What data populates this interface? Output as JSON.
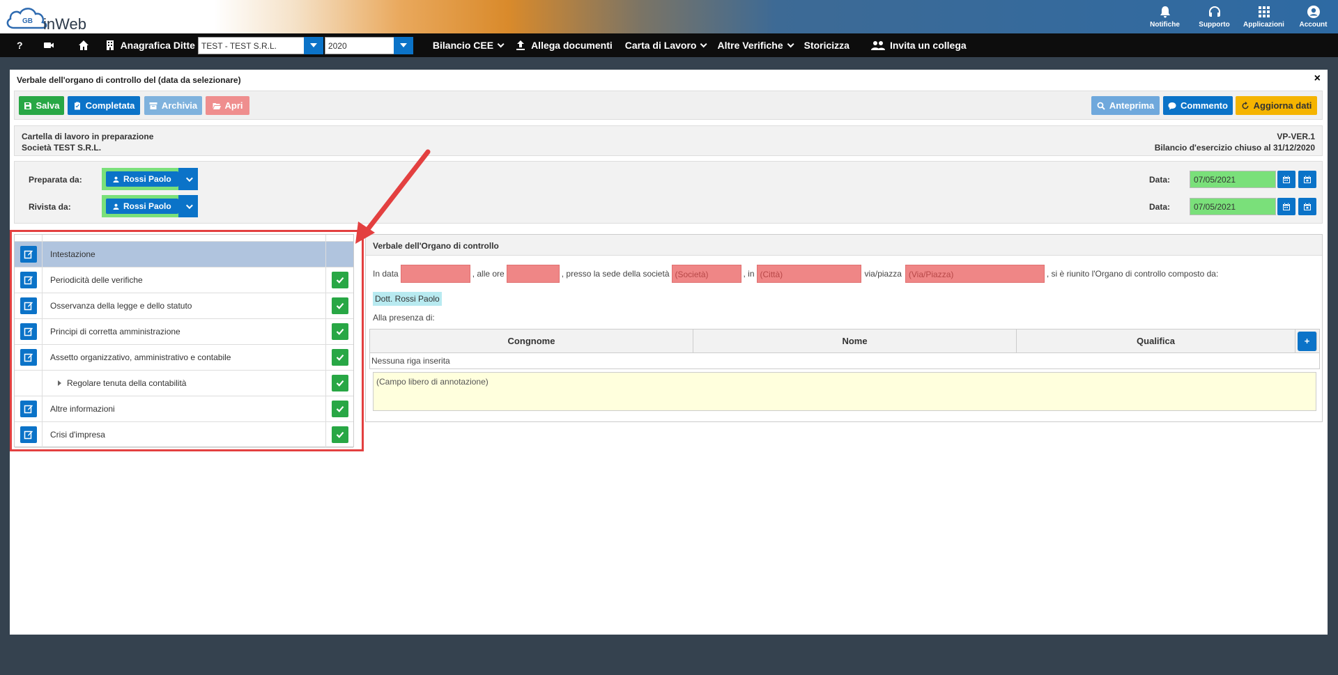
{
  "header": {
    "logo_text": "inWeb",
    "logo_badge": "GB",
    "icons": [
      {
        "label": "Notifiche",
        "icon": "bell-icon"
      },
      {
        "label": "Supporto",
        "icon": "headset-icon"
      },
      {
        "label": "Applicazioni",
        "icon": "grid-icon"
      },
      {
        "label": "Account",
        "icon": "user-circle-icon"
      }
    ]
  },
  "menubar": {
    "help": "?",
    "anagrafica": "Anagrafica Ditte",
    "company_value": "TEST - TEST S.R.L.",
    "year_value": "2020",
    "bilancio": "Bilancio CEE",
    "allega": "Allega documenti",
    "carta": "Carta di Lavoro",
    "altre": "Altre Verifiche",
    "storicizza": "Storicizza",
    "invita": "Invita un collega"
  },
  "panel": {
    "title": "Verbale dell'organo di controllo del (data da selezionare)",
    "close": "×"
  },
  "toolbar": {
    "salva": "Salva",
    "completata": "Completata",
    "archivia": "Archivia",
    "apri": "Apri",
    "anteprima": "Anteprima",
    "commento": "Commento",
    "aggiorna": "Aggiorna dati",
    "colors": {
      "green": "#28a745",
      "blue": "#0b73c8",
      "lightblue": "#7fb2dd",
      "pink": "#ef8e8e",
      "anteprima": "#6fa8dc",
      "orange": "#f5b400"
    }
  },
  "info": {
    "line1": "Cartella di lavoro in preparazione",
    "line2": "Società TEST S.R.L.",
    "right1": "VP-VER.1",
    "right2": "Bilancio d'esercizio chiuso al 31/12/2020"
  },
  "prep": {
    "preparata_label": "Preparata da:",
    "preparata_value": "Rossi Paolo",
    "rivista_label": "Rivista da:",
    "rivista_value": "Rossi Paolo",
    "data_label": "Data:",
    "data1": "07/05/2021",
    "data2": "07/05/2021"
  },
  "sections": [
    {
      "label": "Intestazione",
      "selected": true,
      "edit": true,
      "ok": false,
      "sub": false
    },
    {
      "label": "Periodicità delle verifiche",
      "selected": false,
      "edit": true,
      "ok": true,
      "sub": false
    },
    {
      "label": "Osservanza della legge e dello statuto",
      "selected": false,
      "edit": true,
      "ok": true,
      "sub": false
    },
    {
      "label": "Principi di corretta amministrazione",
      "selected": false,
      "edit": true,
      "ok": true,
      "sub": false
    },
    {
      "label": "Assetto organizzativo, amministrativo e contabile",
      "selected": false,
      "edit": true,
      "ok": true,
      "sub": false
    },
    {
      "label": "Regolare tenuta della contabilità",
      "selected": false,
      "edit": false,
      "ok": true,
      "sub": true
    },
    {
      "label": "Altre informazioni",
      "selected": false,
      "edit": true,
      "ok": true,
      "sub": false
    },
    {
      "label": "Crisi d'impresa",
      "selected": false,
      "edit": true,
      "ok": true,
      "sub": false
    }
  ],
  "verbale": {
    "title": "Verbale dell'Organo di controllo",
    "in_data": "In data",
    "alle_ore": ", alle ore",
    "presso": ", presso la sede della società",
    "societa_ph": "(Società)",
    "in": ", in",
    "citta_ph": "(Città)",
    "via": "via/piazza",
    "via_ph": "(Via/Piazza)",
    "riunito": ", si è riunito l'Organo di controllo composto da:",
    "dott": "Dott. Rossi Paolo",
    "alla": "Alla presenza di:",
    "col_cognome": "Congnome",
    "col_nome": "Nome",
    "col_qualifica": "Qualifica",
    "plus": "+",
    "empty": "Nessuna riga inserita",
    "notes": "(Campo libero di annotazione)"
  }
}
